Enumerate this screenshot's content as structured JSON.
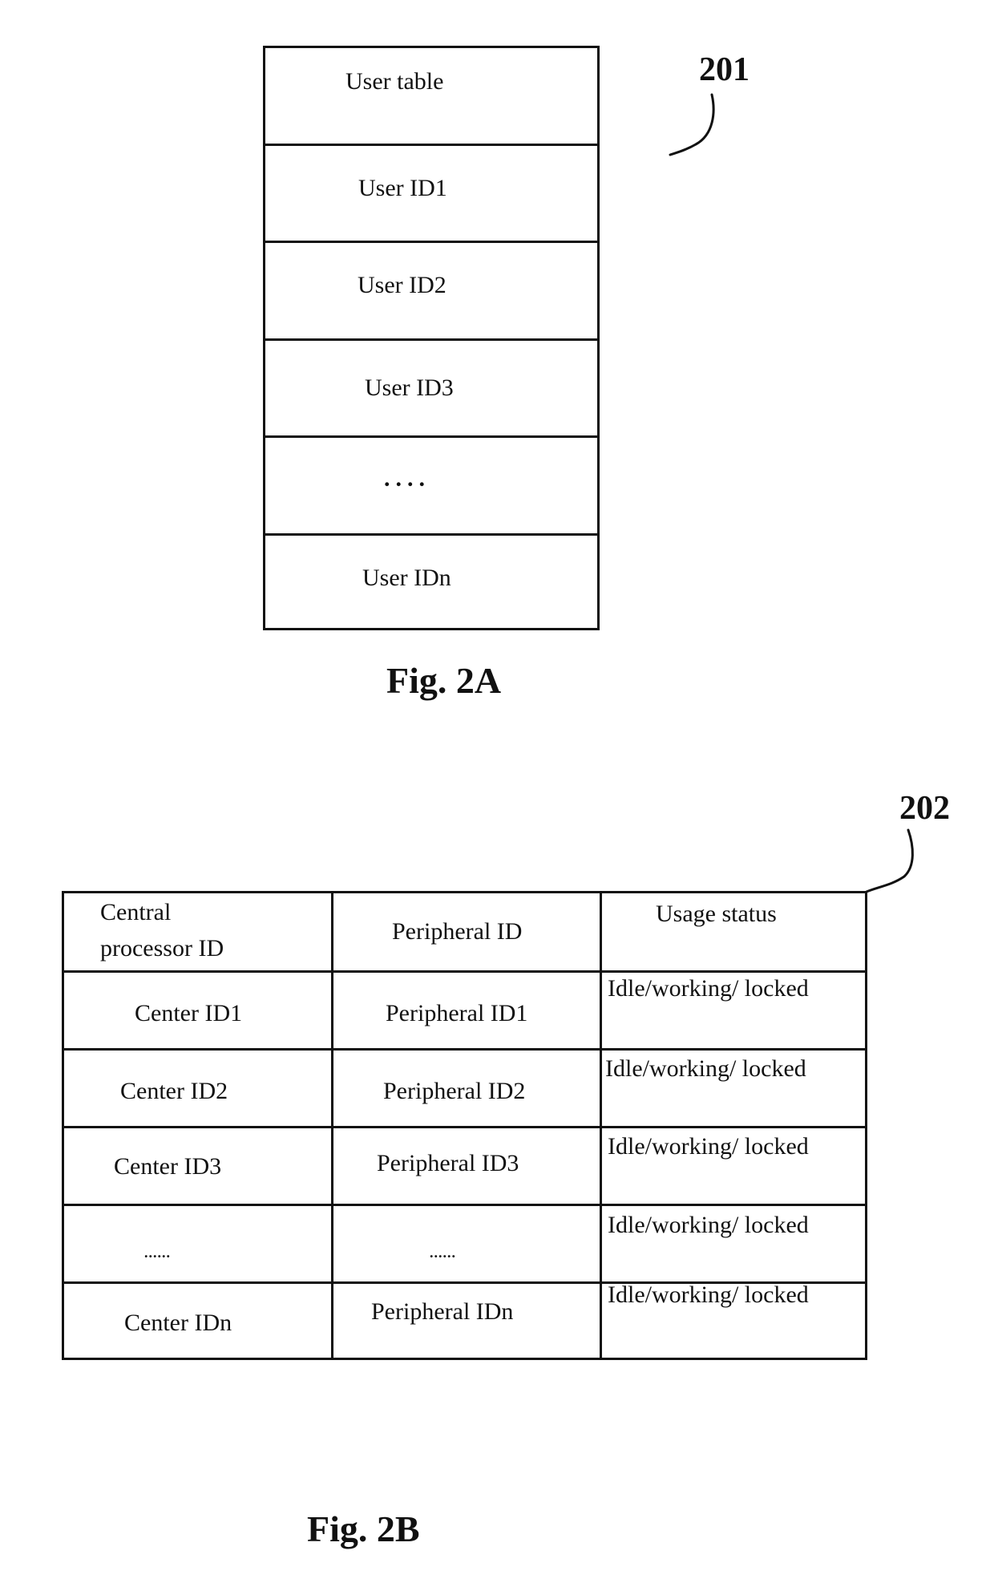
{
  "fig_2a": {
    "reference_number": "201",
    "caption": "Fig. 2A",
    "rows": [
      "User table",
      "User ID1",
      "User ID2",
      "User ID3",
      "....",
      "User IDn"
    ]
  },
  "fig_2b": {
    "reference_number": "202",
    "caption": "Fig. 2B",
    "headers": {
      "central_processor_line1": "Central",
      "central_processor_line2": "processor ID",
      "peripheral": "Peripheral ID",
      "usage_status": "Usage status"
    },
    "rows": [
      {
        "center": "Center ID1",
        "peripheral": "Peripheral ID1",
        "status": "Idle/working/ locked"
      },
      {
        "center": "Center ID2",
        "peripheral": "Peripheral ID2",
        "status": "Idle/working/ locked"
      },
      {
        "center": "Center ID3",
        "peripheral": "Peripheral ID3",
        "status": "Idle/working/ locked"
      },
      {
        "center": "......",
        "peripheral": "......",
        "status": "Idle/working/ locked"
      },
      {
        "center": "Center IDn",
        "peripheral": "Peripheral IDn",
        "status": "Idle/working/ locked"
      }
    ]
  }
}
